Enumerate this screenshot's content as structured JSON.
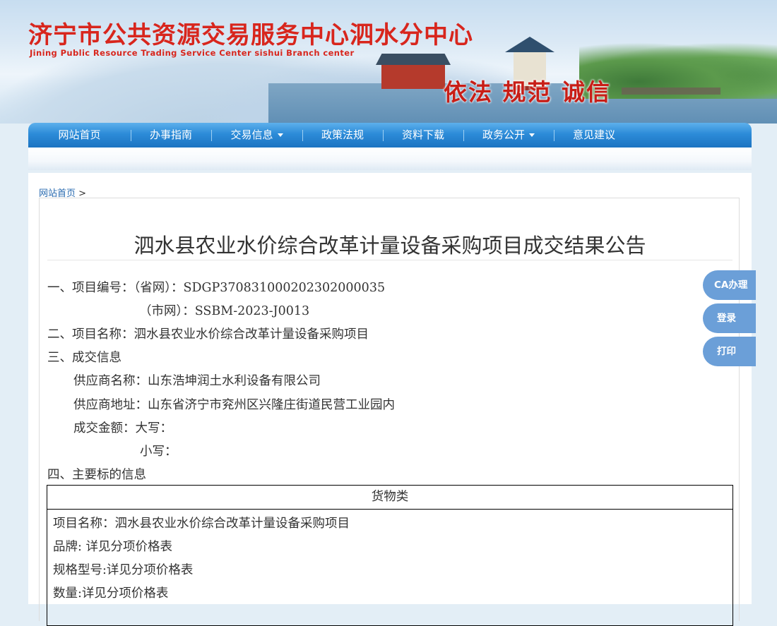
{
  "header": {
    "title": "济宁市公共资源交易服务中心泗水分中心",
    "subtitle": "Jining Public Resource Trading Service Center sishui Branch center",
    "slogan": "依法 规范 诚信"
  },
  "nav": {
    "items": [
      {
        "label": "网站首页",
        "dropdown": false
      },
      {
        "label": "办事指南",
        "dropdown": false
      },
      {
        "label": "交易信息",
        "dropdown": true
      },
      {
        "label": "政策法规",
        "dropdown": false
      },
      {
        "label": "资料下载",
        "dropdown": false
      },
      {
        "label": "政务公开",
        "dropdown": true
      },
      {
        "label": "意见建议",
        "dropdown": false
      }
    ]
  },
  "breadcrumb": {
    "home": "网站首页",
    "separator": ">"
  },
  "document": {
    "title": "泗水县农业水价综合改革计量设备采购项目成交结果公告",
    "lines": [
      "一、项目编号：（省网）：SDGP370831000202302000035",
      "（市网）：SSBM-2023-J0013",
      "二、项目名称：泗水县农业水价综合改革计量设备采购项目",
      "三、成交信息",
      "供应商名称：山东浩坤润土水利设备有限公司",
      "供应商地址：山东省济宁市兖州区兴隆庄街道民营工业园内",
      "成交金额：大写：",
      "小写：",
      "四、主要标的信息"
    ],
    "goods_table": {
      "header": "货物类",
      "rows": [
        "项目名称：泗水县农业水价综合改革计量设备采购项目",
        "品牌: 详见分项价格表",
        "规格型号:详见分项价格表",
        "数量:详见分项价格表"
      ]
    }
  },
  "side_buttons": {
    "ca": "CA办理",
    "login": "登录",
    "print": "打印"
  },
  "colors": {
    "title_red": "#d8261d",
    "nav_blue": "#2c8bd8",
    "side_button_blue": "#6b9fd8",
    "link_blue": "#2a6bb0"
  }
}
